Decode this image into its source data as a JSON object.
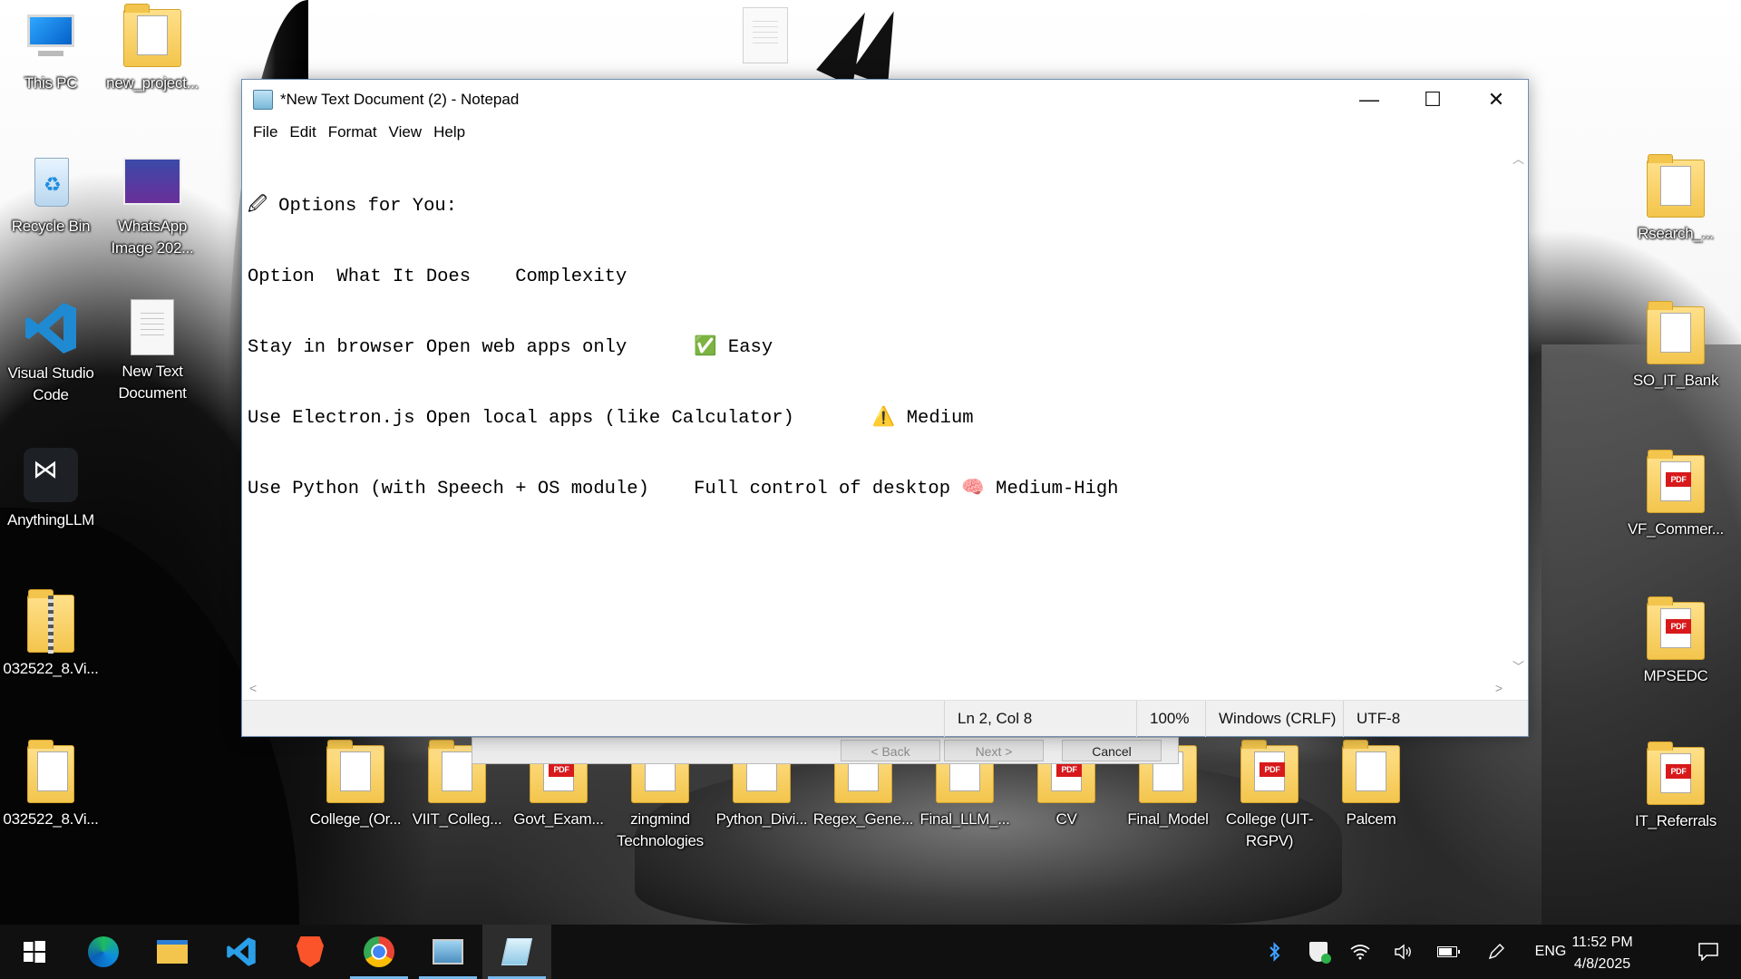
{
  "window": {
    "title": "*New Text Document (2) - Notepad",
    "minimize_glyph": "—",
    "maximize_glyph": "☐",
    "close_glyph": "✕"
  },
  "menu": [
    "File",
    "Edit",
    "Format",
    "View",
    "Help"
  ],
  "editor": {
    "lines": [
      "🖉 Options for You:",
      "Option  What It Does    Complexity",
      "Stay in browser Open web apps only      ✅ Easy",
      "Use Electron.js Open local apps (like Calculator)       ⚠️ Medium",
      "Use Python (with Speech + OS module)    Full control of desktop 🧠 Medium-High"
    ]
  },
  "statusbar": {
    "position": "Ln 2, Col 8",
    "zoom": "100%",
    "line_ending": "Windows (CRLF)",
    "encoding": "UTF-8"
  },
  "dialog_behind": {
    "back": "< Back",
    "next": "Next >",
    "cancel": "Cancel"
  },
  "desktop_icons": {
    "left": [
      {
        "label": "This PC",
        "icon": "computer-icon"
      },
      {
        "label": "new_project...",
        "icon": "folder-icon"
      },
      {
        "label": "Recycle Bin",
        "icon": "recycle-bin-icon"
      },
      {
        "label": "WhatsApp Image 202...",
        "icon": "image-file-icon"
      },
      {
        "label": "Visual Studio Code",
        "icon": "vscode-icon"
      },
      {
        "label": "New Text Document",
        "icon": "text-document-icon"
      },
      {
        "label": "AnythingLLM",
        "icon": "anythingllm-icon"
      },
      {
        "label": "032522_8.Vi...",
        "icon": "zip-folder-icon"
      },
      {
        "label": "032522_8.Vi...",
        "icon": "folder-icon"
      }
    ],
    "bottom": [
      {
        "label": "College_(Or...",
        "icon": "folder-icon"
      },
      {
        "label": "VIIT_Colleg...",
        "icon": "folder-icon"
      },
      {
        "label": "Govt_Exam...",
        "icon": "pdf-folder-icon"
      },
      {
        "label": "zingmind Technologies",
        "icon": "folder-icon"
      },
      {
        "label": "Python_Divi...",
        "icon": "folder-icon"
      },
      {
        "label": "Regex_Gene...",
        "icon": "folder-icon"
      },
      {
        "label": "Final_LLM_...",
        "icon": "folder-icon"
      },
      {
        "label": "CV",
        "icon": "pdf-folder-icon"
      },
      {
        "label": "Final_Model",
        "icon": "folder-icon"
      },
      {
        "label": "College (UIT-RGPV)",
        "icon": "pdf-folder-icon"
      },
      {
        "label": "Palcem",
        "icon": "folder-icon"
      }
    ],
    "right": [
      {
        "label": "Rsearch_...",
        "icon": "folder-icon"
      },
      {
        "label": "SO_IT_Bank",
        "icon": "folder-icon"
      },
      {
        "label": "VF_Commer...",
        "icon": "pdf-folder-icon"
      },
      {
        "label": "MPSEDC",
        "icon": "pdf-folder-icon"
      },
      {
        "label": "IT_Referrals",
        "icon": "pdf-folder-icon"
      }
    ]
  },
  "taskbar": {
    "apps": [
      {
        "name": "start",
        "icon": "windows-start-icon"
      },
      {
        "name": "edge",
        "icon": "edge-browser-icon"
      },
      {
        "name": "explorer",
        "icon": "file-explorer-icon"
      },
      {
        "name": "vscode",
        "icon": "vscode-icon"
      },
      {
        "name": "brave",
        "icon": "brave-browser-icon"
      },
      {
        "name": "chrome",
        "icon": "chrome-browser-icon"
      },
      {
        "name": "photos",
        "icon": "photos-icon"
      },
      {
        "name": "notepad",
        "icon": "notepad-icon"
      }
    ],
    "language": "ENG",
    "time": "11:52 PM",
    "date": "4/8/2025"
  }
}
